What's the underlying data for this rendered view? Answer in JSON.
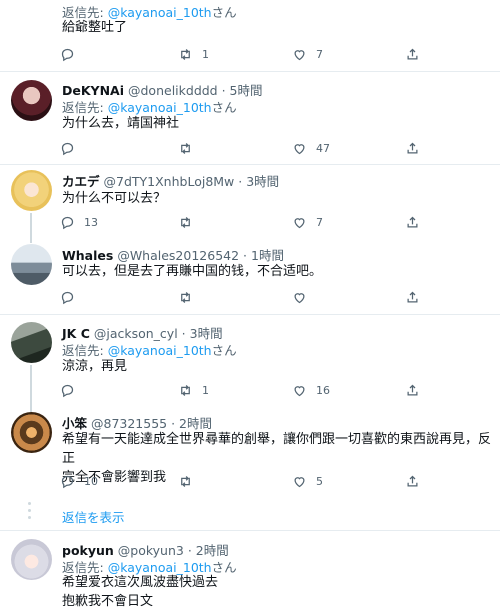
{
  "tweets": [
    {
      "reply_prefix": "返信先: ",
      "reply_handle": "@kayanoai_10th",
      "reply_suffix": "さん",
      "text": "給爺整吐了",
      "replies": "",
      "retweets": "1",
      "likes": "7"
    },
    {
      "name": "DeKYNAi",
      "handle": "@donelikdddd",
      "time": "· 5時間",
      "reply_prefix": "返信先: ",
      "reply_handle": "@kayanoai_10th",
      "reply_suffix": "さん",
      "text": "为什么去，靖国神社",
      "replies": "",
      "retweets": "",
      "likes": "47"
    },
    {
      "name": "カエデ",
      "handle": "@7dTY1XnhbLoj8Mw",
      "time": "· 3時間",
      "text": "为什么不可以去？",
      "replies": "13",
      "retweets": "",
      "likes": "7"
    },
    {
      "name": "Whales",
      "handle": "@Whales20126542",
      "time": "· 1時間",
      "text": "可以去，但是去了再賺中国的钱，不合适吧。",
      "replies": "",
      "retweets": "",
      "likes": ""
    },
    {
      "name": "JK C",
      "handle": "@jackson_cyl",
      "time": "· 3時間",
      "reply_prefix": "返信先: ",
      "reply_handle": "@kayanoai_10th",
      "reply_suffix": "さん",
      "text": "涼涼，再見",
      "replies": "",
      "retweets": "1",
      "likes": "16"
    },
    {
      "name": "小笨",
      "handle": "@87321555",
      "time": "· 2時間",
      "text_line1": "希望有一天能達成全世界尋華的創舉，讓你們跟一切喜歡的東西說再見，反正",
      "text_line2": "完全不會影響到我",
      "replies": "10",
      "retweets": "",
      "likes": "5",
      "show_more": "返信を表示"
    },
    {
      "name": "pokyun",
      "handle": "@pokyun3",
      "time": "· 2時間",
      "reply_prefix": "返信先: ",
      "reply_handle": "@kayanoai_10th",
      "reply_suffix": "さん",
      "text_line1": "希望爱衣這次風波盡快過去",
      "text_line2": "抱歉我不會日文"
    }
  ],
  "icons": {
    "reply": "reply-icon",
    "retweet": "retweet-icon",
    "like": "like-icon",
    "share": "share-icon"
  },
  "colors": {
    "link": "#1d9bf0",
    "muted": "#536471",
    "border": "#e6ecf0"
  }
}
